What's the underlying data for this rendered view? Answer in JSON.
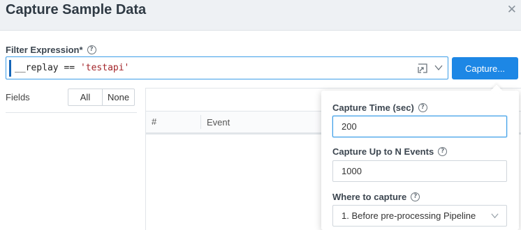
{
  "dialog": {
    "title": "Capture Sample Data"
  },
  "filter": {
    "label": "Filter Expression*",
    "expr_ident": "__replay",
    "expr_op": " == ",
    "expr_string": "'testapi'",
    "capture_button": "Capture..."
  },
  "fields": {
    "label": "Fields",
    "all": "All",
    "none": "None"
  },
  "table": {
    "columns": [
      "#",
      "Event"
    ]
  },
  "capture_popover": {
    "time_label": "Capture Time (sec)",
    "time_value": "200",
    "events_label": "Capture Up to N Events",
    "events_value": "1000",
    "where_label": "Where to capture",
    "where_value": "1. Before pre-processing Pipeline"
  }
}
